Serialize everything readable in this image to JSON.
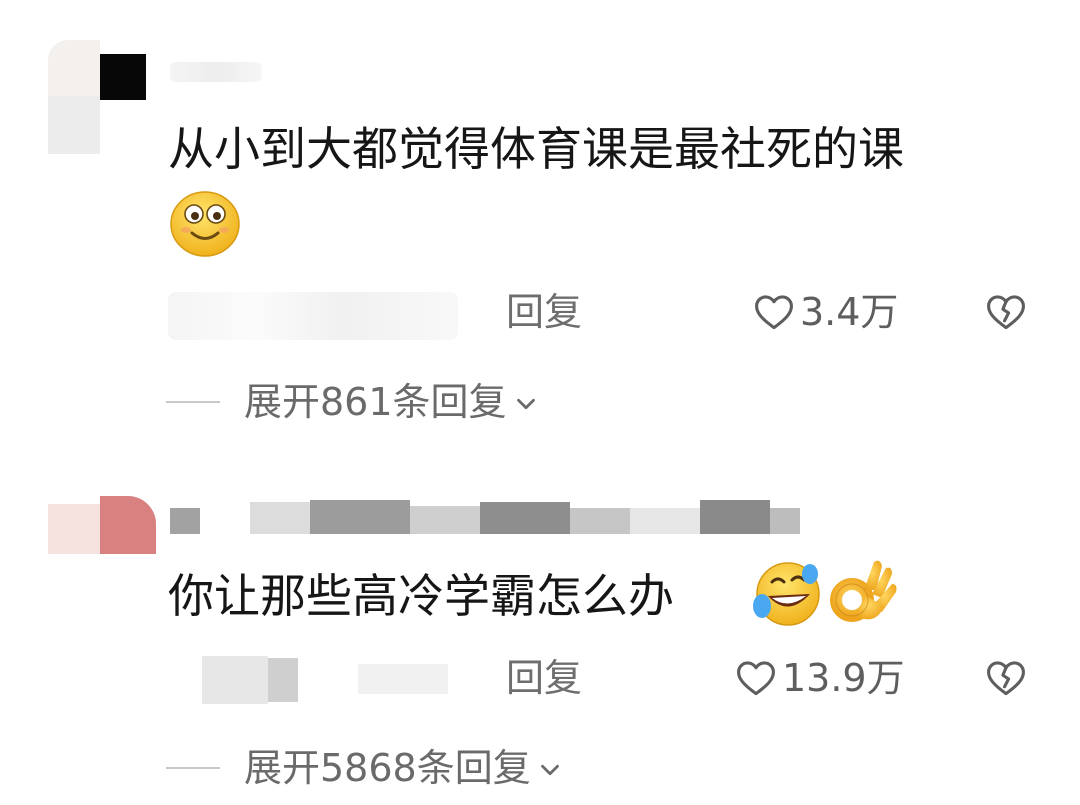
{
  "comments": [
    {
      "text": "从小到大都觉得体育课是最社死的课",
      "emoji": "smiling-face-emoji",
      "reply_label": "回复",
      "like_count": "3.4万",
      "expand_label": "展开861条回复"
    },
    {
      "text": "你让那些高冷学霸怎么办",
      "emojis": [
        "rolling-on-floor-laughing-emoji",
        "ok-hand-emoji"
      ],
      "reply_label": "回复",
      "like_count": "13.9万",
      "expand_label": "展开5868条回复"
    }
  ],
  "icons": {
    "like": "heart-outline-icon",
    "dislike": "broken-heart-icon",
    "expand": "chevron-down-icon"
  },
  "colors": {
    "text": "#161616",
    "secondary": "#6e6e6e",
    "emoji_yellow": "#f9c233"
  }
}
